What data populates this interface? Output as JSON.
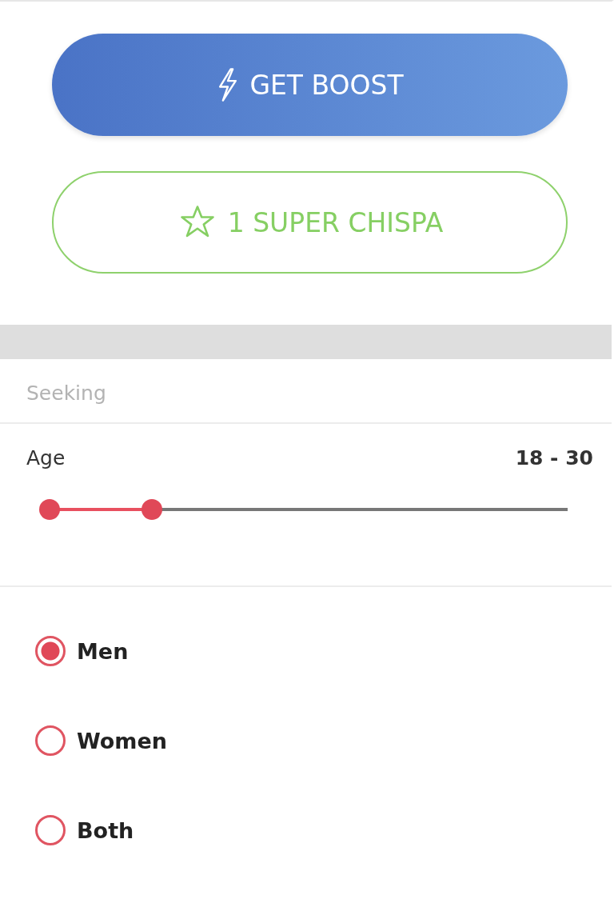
{
  "actions": [
    {
      "kind": "boost",
      "label": "GET BOOST"
    },
    {
      "kind": "super",
      "label": "1 SUPER CHISPA"
    }
  ],
  "section_title": "Seeking",
  "age": {
    "label": "Age",
    "reading": "18 - 30",
    "thumbs": [
      {
        "level": 0
      },
      {
        "level": 0.198
      }
    ]
  },
  "gender_options": [
    {
      "label": "Men",
      "selected": true
    },
    {
      "label": "Women",
      "selected": false
    },
    {
      "label": "Both",
      "selected": false
    }
  ]
}
